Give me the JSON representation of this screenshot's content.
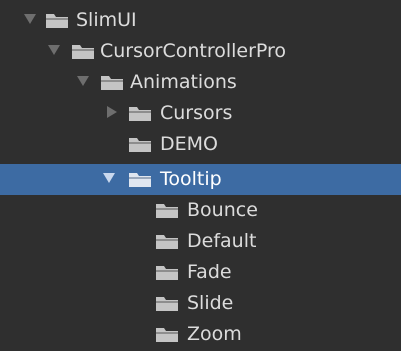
{
  "tree": {
    "items": [
      {
        "label": "SlimUI",
        "expander": "expanded",
        "selected": false,
        "icon": "folder-icon"
      },
      {
        "label": "CursorControllerPro",
        "expander": "expanded",
        "selected": false,
        "icon": "folder-icon"
      },
      {
        "label": "Animations",
        "expander": "expanded",
        "selected": false,
        "icon": "folder-icon"
      },
      {
        "label": "Cursors",
        "expander": "collapsed",
        "selected": false,
        "icon": "folder-icon"
      },
      {
        "label": "DEMO",
        "expander": "none",
        "selected": false,
        "icon": "folder-icon"
      },
      {
        "label": "Tooltip",
        "expander": "expanded",
        "selected": true,
        "icon": "folder-icon"
      },
      {
        "label": "Bounce",
        "expander": "none",
        "selected": false,
        "icon": "folder-icon"
      },
      {
        "label": "Default",
        "expander": "none",
        "selected": false,
        "icon": "folder-icon"
      },
      {
        "label": "Fade",
        "expander": "none",
        "selected": false,
        "icon": "folder-icon"
      },
      {
        "label": "Slide",
        "expander": "none",
        "selected": false,
        "icon": "folder-icon"
      },
      {
        "label": "Zoom",
        "expander": "none",
        "selected": false,
        "icon": "folder-icon"
      }
    ]
  },
  "colors": {
    "background": "#2f2f2f",
    "selection": "#3d6ba3",
    "text": "#dcdcdc",
    "folder": "#c4c4c4"
  }
}
